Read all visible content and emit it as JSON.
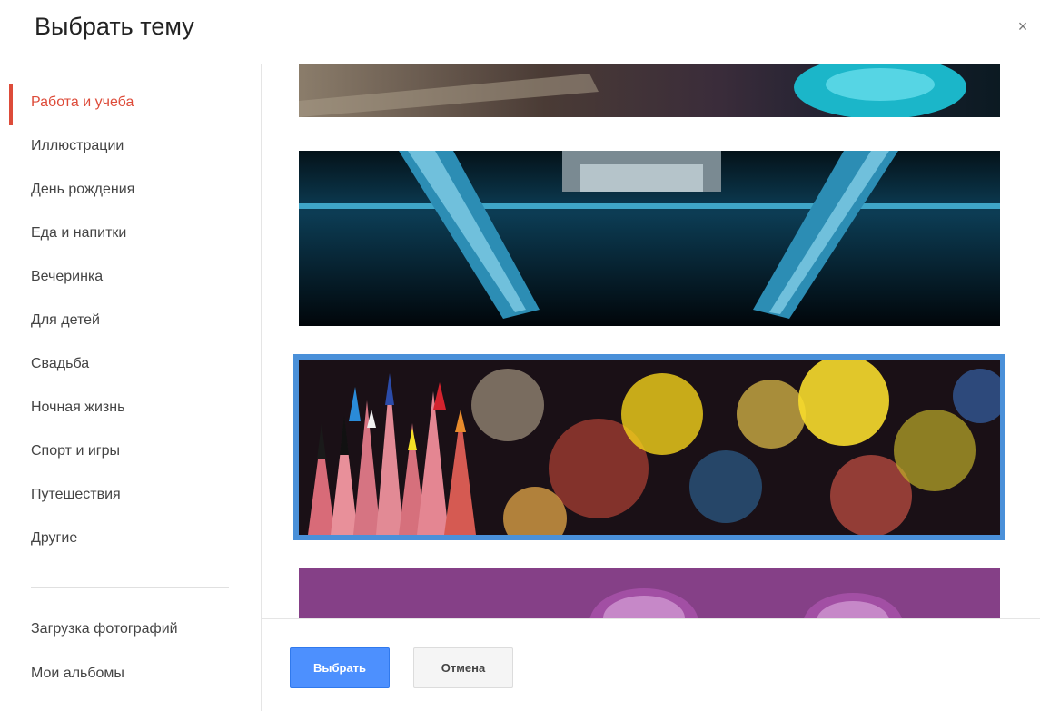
{
  "dialog": {
    "title": "Выбрать тему",
    "close_symbol": "×"
  },
  "sidebar": {
    "categories": [
      {
        "label": "Работа и учеба",
        "active": true
      },
      {
        "label": "Иллюстрации"
      },
      {
        "label": "День рождения"
      },
      {
        "label": "Еда и напитки"
      },
      {
        "label": "Вечеринка"
      },
      {
        "label": "Для детей"
      },
      {
        "label": "Свадьба"
      },
      {
        "label": "Ночная жизнь"
      },
      {
        "label": "Спорт и игры"
      },
      {
        "label": "Путешествия"
      },
      {
        "label": "Другие"
      }
    ],
    "extra": [
      {
        "label": "Загрузка фотографий"
      },
      {
        "label": "Мои альбомы"
      }
    ]
  },
  "themes": [
    {
      "name": "tools-banner",
      "colors": [
        "#4a3b35",
        "#a89a86",
        "#1bb6c9"
      ]
    },
    {
      "name": "microscope-banner",
      "colors": [
        "#02090f",
        "#1d7fa8",
        "#6ed3f0"
      ]
    },
    {
      "name": "pencils-bokeh-banner",
      "colors": [
        "#1a1016",
        "#f4d21a",
        "#e55b4d"
      ],
      "selected": true
    },
    {
      "name": "purple-drops-banner",
      "colors": [
        "#6b2a6e",
        "#b86ab8",
        "#e3b8e6"
      ]
    }
  ],
  "footer": {
    "select_label": "Выбрать",
    "cancel_label": "Отмена"
  },
  "colors": {
    "accent": "#dd4b39",
    "primary_button": "#4d90fe",
    "selection_border": "#4a90d9"
  }
}
